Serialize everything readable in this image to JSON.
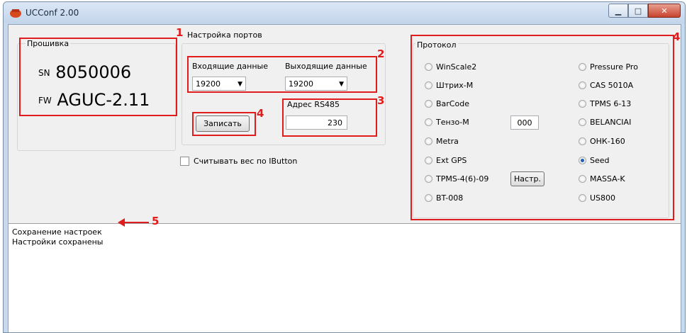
{
  "window": {
    "title": "UCConf 2.00"
  },
  "firmware": {
    "group_label": "Прошивка",
    "sn_prefix": "SN",
    "sn_value": "8050006",
    "fw_prefix": "FW",
    "fw_value": "AGUC-2.11"
  },
  "ports": {
    "group_label": "Настройка портов",
    "incoming_label": "Входящие данные",
    "incoming_value": "19200",
    "outgoing_label": "Выходящие данные",
    "outgoing_value": "19200",
    "rs485_label": "Адрес RS485",
    "rs485_value": "230",
    "write_button": "Записать"
  },
  "ibutton_checkbox": "Считывать вес по IButton",
  "protocol": {
    "group_label": "Протокол",
    "left": [
      "WinScale2",
      "Штрих-М",
      "BarCode",
      "Тензо-М",
      "Metra",
      "Ext GPS",
      "TPMS-4(6)-09",
      "BT-008"
    ],
    "right": [
      "Pressure Pro",
      "CAS 5010A",
      "TPMS 6-13",
      "BELANCIAI",
      "ОНК-160",
      "Seed",
      "MASSA-K",
      "US800"
    ],
    "selected": "Seed",
    "tenzo_value": "000",
    "setup_button": "Настр."
  },
  "log": {
    "lines": [
      "Сохранение настроек",
      "Настройки сохранены"
    ]
  },
  "annotations": {
    "n1": "1",
    "n2": "2",
    "n3": "3",
    "n4a": "4",
    "n4b": "4",
    "n5": "5"
  },
  "colors": {
    "annotation": "#e01c1c",
    "titlebar": "#c9d9ec",
    "selected_radio": "#1d5fb8"
  }
}
